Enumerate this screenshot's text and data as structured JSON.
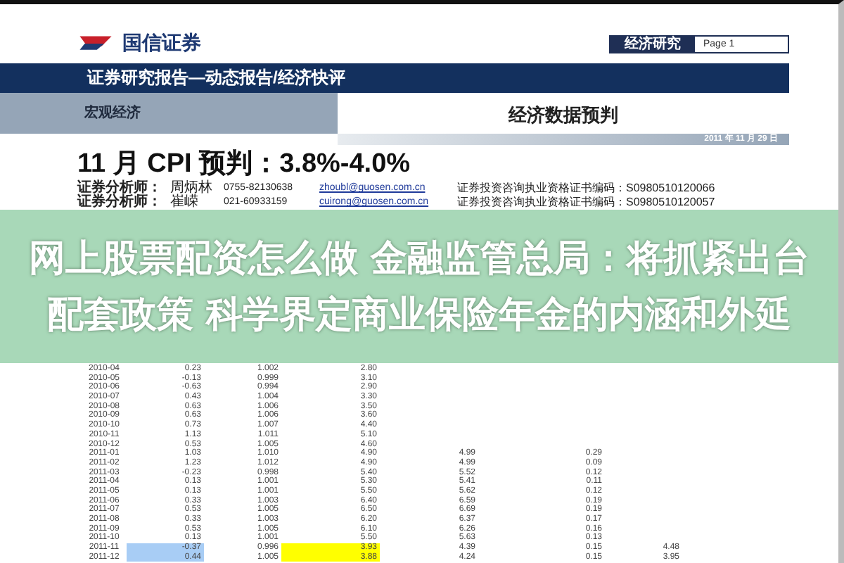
{
  "header": {
    "brand": "国信证券",
    "section_tag": "经济研究",
    "page": "Page 1"
  },
  "banner": {
    "title": "证券研究报告—动态报告/经济快评"
  },
  "category": "宏观经济",
  "report_type": "经济数据预判",
  "date": "2011 年 11 月 29 日",
  "headline": "11 月 CPI 预判：3.8%-4.0%",
  "analysts": [
    {
      "label": "证券分析师：",
      "name": "周炳林",
      "phone": "0755-82130638",
      "email": "zhoubl@guosen.com.cn",
      "cert": "证券投资咨询执业资格证书编码：S0980510120066"
    },
    {
      "label": "证券分析师：",
      "name": "崔嵘",
      "phone": "021-60933159",
      "email": "cuirong@guosen.com.cn",
      "cert": "证券投资咨询执业资格证书编码：S0980510120057"
    }
  ],
  "table": {
    "rows": [
      {
        "cells": [
          "2010-04",
          "0.23",
          "1.002",
          "2.80"
        ]
      },
      {
        "cells": [
          "2010-05",
          "-0.13",
          "0.999",
          "3.10"
        ]
      },
      {
        "cells": [
          "2010-06",
          "-0.63",
          "0.994",
          "2.90"
        ]
      },
      {
        "cells": [
          "2010-07",
          "0.43",
          "1.004",
          "3.30"
        ]
      },
      {
        "cells": [
          "2010-08",
          "0.63",
          "1.006",
          "3.50"
        ]
      },
      {
        "cells": [
          "2010-09",
          "0.63",
          "1.006",
          "3.60"
        ]
      },
      {
        "cells": [
          "2010-10",
          "0.73",
          "1.007",
          "4.40"
        ]
      },
      {
        "cells": [
          "2010-11",
          "1.13",
          "1.011",
          "5.10"
        ]
      },
      {
        "cells": [
          "2010-12",
          "0.53",
          "1.005",
          "4.60"
        ]
      },
      {
        "cells": [
          "2011-01",
          "1.03",
          "1.010",
          "4.90",
          "4.99",
          "0.29"
        ]
      },
      {
        "cells": [
          "2011-02",
          "1.23",
          "1.012",
          "4.90",
          "4.99",
          "0.09"
        ]
      },
      {
        "cells": [
          "2011-03",
          "-0.23",
          "0.998",
          "5.40",
          "5.52",
          "0.12"
        ]
      },
      {
        "cells": [
          "2011-04",
          "0.13",
          "1.001",
          "5.30",
          "5.41",
          "0.11"
        ]
      },
      {
        "cells": [
          "2011-05",
          "0.13",
          "1.001",
          "5.50",
          "5.62",
          "0.12"
        ]
      },
      {
        "cells": [
          "2011-06",
          "0.33",
          "1.003",
          "6.40",
          "6.59",
          "0.19"
        ]
      },
      {
        "cells": [
          "2011-07",
          "0.53",
          "1.005",
          "6.50",
          "6.69",
          "0.19"
        ]
      },
      {
        "cells": [
          "2011-08",
          "0.33",
          "1.003",
          "6.20",
          "6.37",
          "0.17"
        ]
      },
      {
        "cells": [
          "2011-09",
          "0.53",
          "1.005",
          "6.10",
          "6.26",
          "0.16"
        ]
      },
      {
        "cells": [
          "2011-10",
          "0.13",
          "1.001",
          "5.50",
          "5.63",
          "0.13"
        ]
      },
      {
        "cells": [
          "2011-11",
          {
            "text": "-0.37",
            "color": "#a8cdf5"
          },
          "0.996",
          {
            "text": "3.93",
            "color": "#ffff00"
          },
          "4.39",
          "0.15",
          "4.48"
        ]
      },
      {
        "cells": [
          "2011-12",
          {
            "text": "0.44",
            "color": "#a8cdf5"
          },
          "1.005",
          {
            "text": "3.88",
            "color": "#ffff00"
          },
          "4.24",
          "0.15",
          "3.95"
        ]
      }
    ]
  },
  "overlay": {
    "lines": [
      "网上股票配资怎么做 金融监管总局：将抓紧出台",
      "配套政策 科学界定商业保险年金的内涵和外延"
    ]
  }
}
